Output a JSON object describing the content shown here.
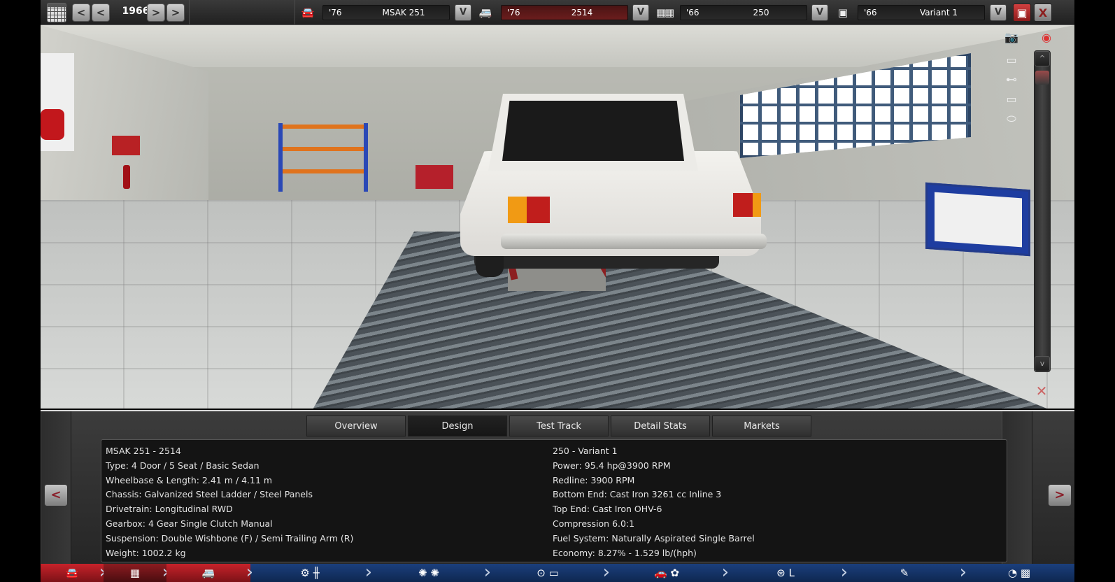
{
  "topbar": {
    "year": "1966",
    "calendar_icon": "calendar-icon",
    "prev_arrow": "<",
    "next_arrow": ">",
    "dropdown_glyph": "V",
    "selectors": [
      {
        "icon": "car-model-icon",
        "year": "'76",
        "name": "MSAK 251",
        "style": "dark"
      },
      {
        "icon": "trim-icon",
        "year": "'76",
        "name": "2514",
        "style": "red"
      },
      {
        "icon": "engine-family-icon",
        "year": "'66",
        "name": "250",
        "style": "dark"
      },
      {
        "icon": "engine-variant-icon",
        "year": "'66",
        "name": "Variant 1",
        "style": "dark"
      }
    ],
    "save_icon": "save-icon",
    "close_glyph": "X"
  },
  "viewport": {
    "right_tools": [
      "camera-icon",
      "view-front-icon",
      "view-side-icon",
      "view-rear-icon",
      "view-top-icon"
    ],
    "scroll_up": "^",
    "scroll_down": "v",
    "close_glyph": "✕",
    "record_icon": "eye-icon"
  },
  "tabs": [
    {
      "label": "Overview",
      "active": false
    },
    {
      "label": "Design",
      "active": true
    },
    {
      "label": "Test Track",
      "active": false
    },
    {
      "label": "Detail Stats",
      "active": false
    },
    {
      "label": "Markets",
      "active": false
    }
  ],
  "info": {
    "left": [
      "MSAK 251 - 2514",
      "Type: 4 Door / 5 Seat / Basic Sedan",
      "Wheelbase & Length: 2.41 m / 4.11 m",
      "Chassis: Galvanized Steel Ladder / Steel Panels",
      "Drivetrain: Longitudinal RWD",
      "Gearbox: 4 Gear Single Clutch Manual",
      "Suspension: Double Wishbone (F) / Semi Trailing Arm (R)",
      "Weight: 1002.2 kg"
    ],
    "right": [
      "250 - Variant 1",
      "Power: 95.4 hp@3900 RPM",
      "Redline: 3900 RPM",
      "Bottom End: Cast Iron 3261 cc Inline 3",
      "Top End: Cast Iron OHV-6",
      "Compression 6.0:1",
      "Fuel System: Naturally Aspirated Single Barrel",
      "Economy: 8.27% - 1.529 lb/(hph)"
    ]
  },
  "nav_arrows": {
    "prev": "<",
    "next": ">"
  },
  "nav": [
    {
      "name": "car-model-icon",
      "glyph": "🚘",
      "active": true
    },
    {
      "name": "engine-icon",
      "glyph": "▦",
      "active": true
    },
    {
      "name": "trim-icon",
      "glyph": "🚐",
      "active": true
    },
    {
      "name": "gearbox-icon",
      "glyph": "⚙ ╫",
      "active": false
    },
    {
      "name": "wheels-icon",
      "glyph": "✺ ✺",
      "active": false
    },
    {
      "name": "body-icon",
      "glyph": "⊙ ▭",
      "active": false
    },
    {
      "name": "aero-icon",
      "glyph": "🚗 ✿",
      "active": false
    },
    {
      "name": "interior-icon",
      "glyph": "⊛ L",
      "active": false
    },
    {
      "name": "testing-icon",
      "glyph": "✎",
      "active": false
    },
    {
      "name": "finish-icon",
      "glyph": "◔ ▩",
      "active": false
    }
  ]
}
